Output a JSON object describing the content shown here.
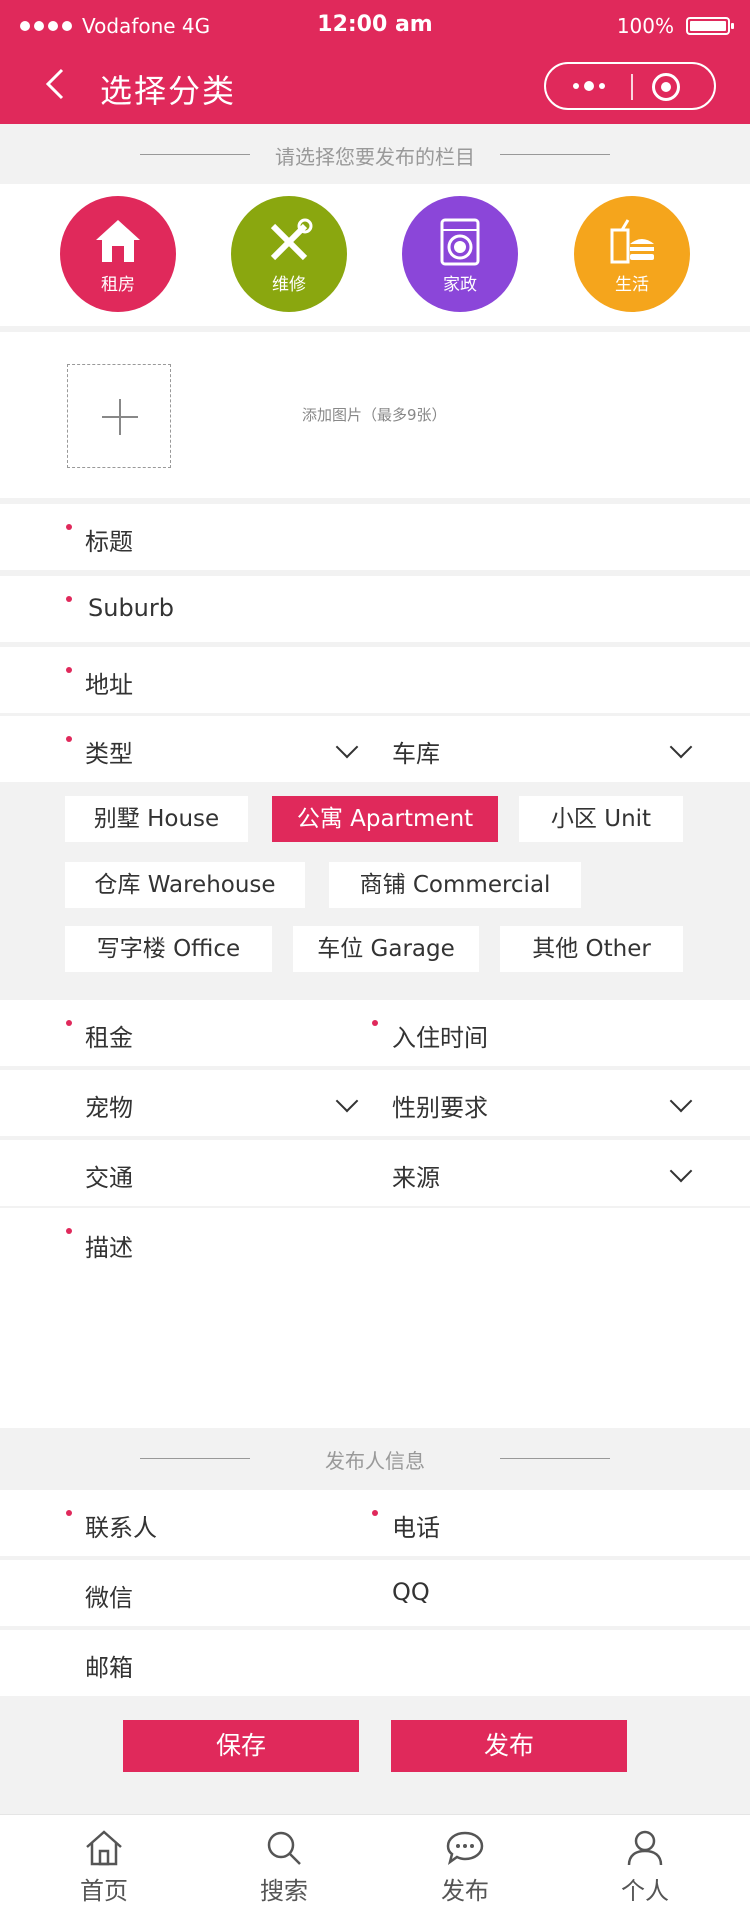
{
  "status_bar": {
    "carrier": "Vodafone 4G",
    "time": "12:00 am",
    "battery": "100%"
  },
  "nav": {
    "title": "选择分类"
  },
  "section_choose": "请选择您要发布的栏目",
  "categories": [
    {
      "label": "租房",
      "icon": "house-icon",
      "color": "#e0295b"
    },
    {
      "label": "维修",
      "icon": "tools-icon",
      "color": "#8aa70f"
    },
    {
      "label": "家政",
      "icon": "washing-machine-icon",
      "color": "#8b46d9"
    },
    {
      "label": "生活",
      "icon": "food-icon",
      "color": "#f5a51c"
    }
  ],
  "upload": {
    "hint": "添加图片（最多9张）"
  },
  "form": {
    "title": "标题",
    "suburb": "Suburb",
    "address": "地址",
    "type": "类型",
    "garage": "车库",
    "rent": "租金",
    "move_in": "入住时间",
    "pets": "宠物",
    "gender": "性别要求",
    "transport": "交通",
    "source": "来源",
    "description": "描述"
  },
  "property_types": [
    {
      "label": "别墅 House",
      "active": false
    },
    {
      "label": "公寓 Apartment",
      "active": true
    },
    {
      "label": "小区 Unit",
      "active": false
    },
    {
      "label": "仓库 Warehouse",
      "active": false
    },
    {
      "label": "商铺 Commercial",
      "active": false
    },
    {
      "label": "写字楼 Office",
      "active": false
    },
    {
      "label": "车位 Garage",
      "active": false
    },
    {
      "label": "其他 Other",
      "active": false
    }
  ],
  "section_publisher": "发布人信息",
  "contact": {
    "name": "联系人",
    "phone": "电话",
    "wechat": "微信",
    "qq": "QQ",
    "email": "邮箱"
  },
  "actions": {
    "save": "保存",
    "publish": "发布"
  },
  "tabbar": [
    {
      "label": "首页",
      "icon": "home-icon"
    },
    {
      "label": "搜索",
      "icon": "search-icon"
    },
    {
      "label": "发布",
      "icon": "chat-icon"
    },
    {
      "label": "个人",
      "icon": "user-icon"
    }
  ],
  "colors": {
    "accent": "#e0295b",
    "background": "#f2f2f2"
  }
}
